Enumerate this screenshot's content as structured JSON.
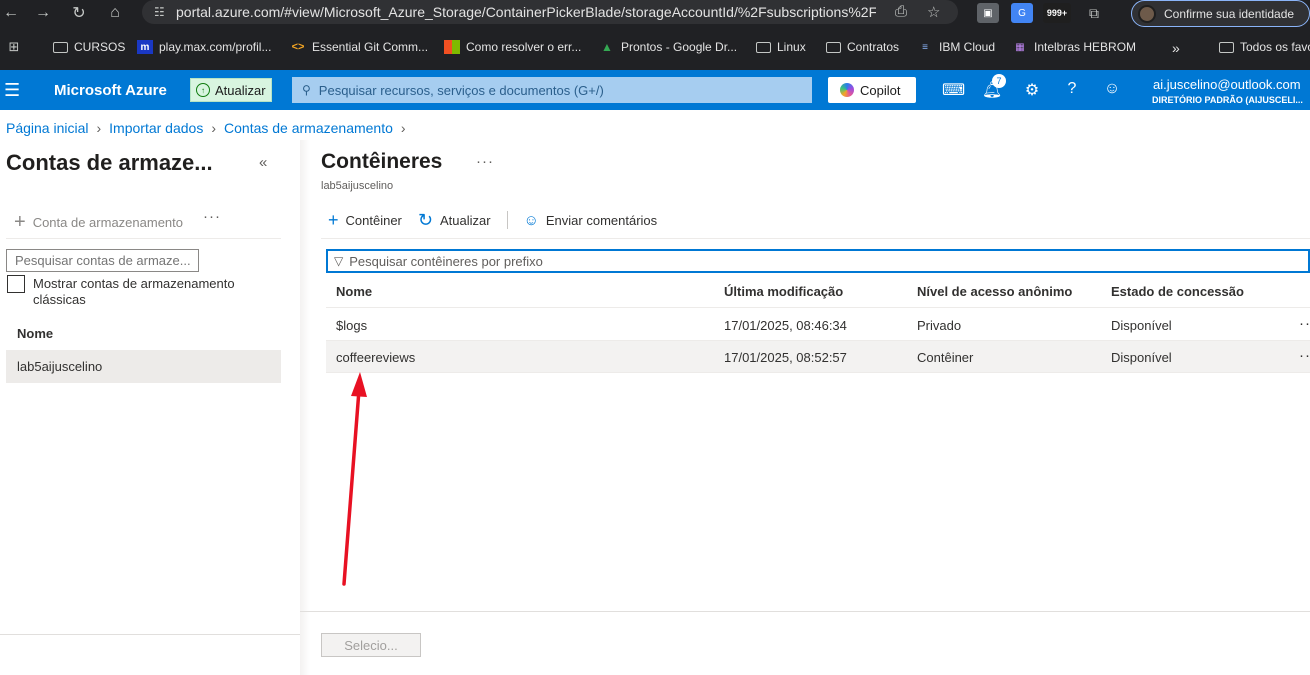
{
  "browser": {
    "url": "portal.azure.com/#view/Microsoft_Azure_Storage/ContainerPickerBlade/storageAccountId/%2Fsubscriptions%2F...",
    "identity_label": "Confirme sua identidade",
    "ext_badge": "999+",
    "bookmarks": [
      {
        "label": "CURSOS",
        "icon": "folder-icon"
      },
      {
        "label": "play.max.com/profil...",
        "icon": "max-icon"
      },
      {
        "label": "Essential Git Comm...",
        "icon": "code-icon"
      },
      {
        "label": "Como resolver o err...",
        "icon": "microsoft-icon"
      },
      {
        "label": "Prontos - Google Dr...",
        "icon": "google-drive-icon"
      },
      {
        "label": "Linux",
        "icon": "folder-icon"
      },
      {
        "label": "Contratos",
        "icon": "folder-icon"
      },
      {
        "label": "IBM Cloud",
        "icon": "ibm-icon"
      },
      {
        "label": "Intelbras HEBROM",
        "icon": "intelbras-icon"
      },
      {
        "label": "Todos os favo",
        "icon": "folder-icon"
      }
    ],
    "more_bookmarks": "»"
  },
  "header": {
    "brand": "Microsoft Azure",
    "update_label": "Atualizar",
    "search_placeholder": "Pesquisar recursos, serviços e documentos (G+/)",
    "copilot_label": "Copilot",
    "notification_count": "7",
    "user_email": "ai.juscelino@outlook.com",
    "user_directory": "DIRETÓRIO PADRÃO (AIJUSCELI..."
  },
  "breadcrumb": [
    "Página inicial",
    "Importar dados",
    "Contas de armazenamento"
  ],
  "left_panel": {
    "title": "Contas de armaze...",
    "add_label": "Conta de armazenamento",
    "search_placeholder": "Pesquisar contas de armaze...",
    "checkbox_label": "Mostrar contas de armazenamento clássicas",
    "column_header": "Nome",
    "rows": [
      "lab5aijuscelino"
    ]
  },
  "right_panel": {
    "title": "Contêineres",
    "subtitle": "lab5aijuscelino",
    "toolbar": {
      "add": "Contêiner",
      "refresh": "Atualizar",
      "feedback": "Enviar comentários"
    },
    "filter_placeholder": "Pesquisar contêineres por prefixo",
    "columns": [
      "Nome",
      "Última modificação",
      "Nível de acesso anônimo",
      "Estado de concessão"
    ],
    "rows": [
      {
        "name": "$logs",
        "modified": "17/01/2025, 08:46:34",
        "access": "Privado",
        "lease": "Disponível"
      },
      {
        "name": "coffeereviews",
        "modified": "17/01/2025, 08:52:57",
        "access": "Contêiner",
        "lease": "Disponível"
      }
    ],
    "select_button": "Selecio..."
  },
  "colors": {
    "azure_blue": "#0078d4",
    "annotation_arrow": "#e81123"
  }
}
